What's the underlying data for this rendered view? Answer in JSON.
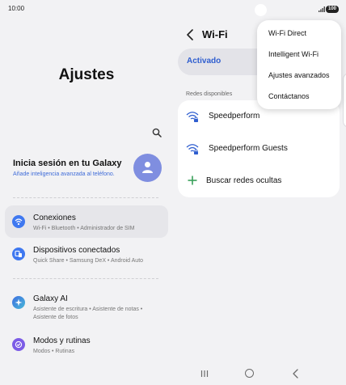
{
  "status_bar": {
    "time": "10:00",
    "battery": "100"
  },
  "left_pane": {
    "title": "Ajustes",
    "galaxy": {
      "title": "Inicia sesión en tu Galaxy",
      "subtitle": "Añade inteligencia avanzada al teléfono."
    },
    "items": [
      {
        "title": "Conexiones",
        "subtitle": "Wi-Fi  •  Bluetooth  •  Administrador de SIM",
        "icon": "wifi-icon",
        "color": "#3f78f0"
      },
      {
        "title": "Dispositivos conectados",
        "subtitle": "Quick Share  •  Samsung DeX  •  Android Auto",
        "icon": "devices-icon",
        "color": "#3f78f0"
      },
      {
        "title": "Galaxy AI",
        "subtitle": "Asistente de escritura  •  Asistente de notas  •  Asistente de fotos",
        "icon": "galaxy-ai-icon",
        "color": "#4f7fe0"
      },
      {
        "title": "Modos y rutinas",
        "subtitle": "Modos  •  Rutinas",
        "icon": "modes-icon",
        "color": "#7c5ce6"
      }
    ]
  },
  "right_pane": {
    "title": "Wi-Fi",
    "toggle_label": "Activado",
    "section_label": "Redes disponibles",
    "networks": [
      {
        "name": "Speedperform"
      },
      {
        "name": "Speedperform Guests"
      }
    ],
    "hidden_networks_label": "Buscar redes ocultas"
  },
  "overflow_menu": {
    "items": [
      "Wi-Fi Direct",
      "Intelligent Wi-Fi",
      "Ajustes avanzados",
      "Contáctanos"
    ]
  },
  "colors": {
    "accent": "#2f5ecf",
    "add_green": "#3aa05a"
  }
}
